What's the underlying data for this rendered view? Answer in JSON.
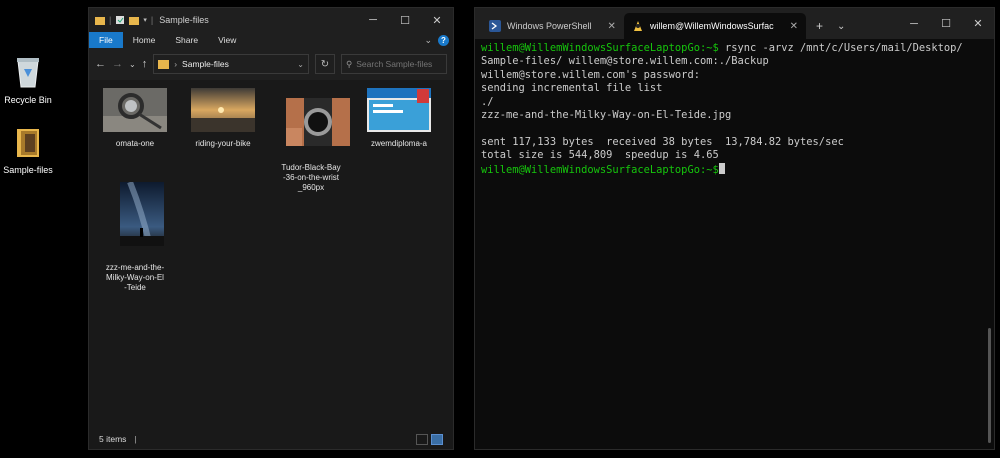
{
  "desktop": {
    "icons": [
      {
        "label": "Recycle Bin"
      },
      {
        "label": "Sample-files"
      }
    ]
  },
  "explorer": {
    "title": "Sample-files",
    "ribbon_tabs": [
      "File",
      "Home",
      "Share",
      "View"
    ],
    "address": "Sample-files",
    "search_placeholder": "Search Sample-files",
    "files": [
      {
        "name": "omata-one"
      },
      {
        "name": "riding-your-bike"
      },
      {
        "name": "Tudor-Black-Bay\n-36-on-the-wrist\n_960px"
      },
      {
        "name": "zwemdiploma-a"
      },
      {
        "name": "zzz-me-and-the-\nMilky-Way-on-El\n-Teide"
      }
    ],
    "status_count": "5 items"
  },
  "terminal": {
    "tabs": [
      {
        "label": "Windows PowerShell"
      },
      {
        "label": "willem@WillemWindowsSurfac"
      }
    ],
    "lines": [
      {
        "prompt": "willem@WillemWindowsSurfaceLaptopGo:~$",
        "text": " rsync -arvz /mnt/c/Users/mail/Desktop/"
      },
      {
        "prompt": "",
        "text": "Sample-files/ willem@store.willem.com:./Backup"
      },
      {
        "prompt": "",
        "text": "willem@store.willem.com's password:"
      },
      {
        "prompt": "",
        "text": "sending incremental file list"
      },
      {
        "prompt": "",
        "text": "./"
      },
      {
        "prompt": "",
        "text": "zzz-me-and-the-Milky-Way-on-El-Teide.jpg"
      },
      {
        "prompt": "",
        "text": " "
      },
      {
        "prompt": "",
        "text": "sent 117,133 bytes  received 38 bytes  13,784.82 bytes/sec"
      },
      {
        "prompt": "",
        "text": "total size is 544,809  speedup is 4.65"
      },
      {
        "prompt": "willem@WillemWindowsSurfaceLaptopGo:~$",
        "text": " "
      }
    ]
  },
  "colors": {
    "accent": "#1979ca",
    "prompt_green": "#16c60c"
  }
}
